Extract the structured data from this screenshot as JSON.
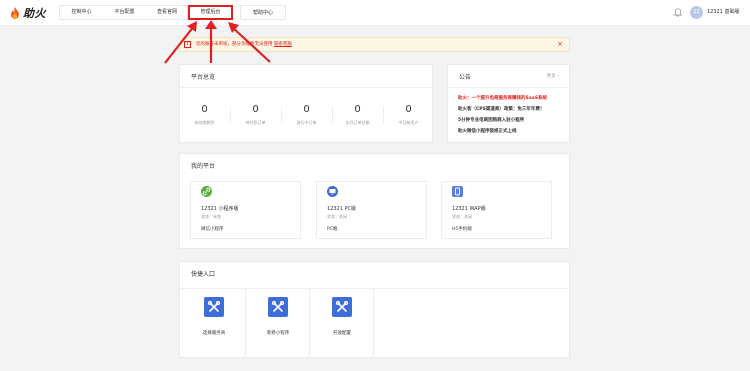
{
  "brand": {
    "name": "助火"
  },
  "nav": {
    "tabs": [
      {
        "label": "控制中心"
      },
      {
        "label": "平台配置"
      },
      {
        "label": "查看官网"
      },
      {
        "label": "管理后台"
      },
      {
        "label": "帮助中心"
      }
    ]
  },
  "header": {
    "avatar_text": "12",
    "username": "12321 基础版"
  },
  "alert": {
    "text": "您的账号未审核，部分功能暂无法使用",
    "link": "联系客服",
    "close": "×",
    "icon": "!"
  },
  "overview": {
    "title": "平台总览",
    "stats": [
      {
        "value": "0",
        "label": "有效期剩余"
      },
      {
        "value": "0",
        "label": "待付款订单"
      },
      {
        "value": "0",
        "label": "进行中订单"
      },
      {
        "value": "0",
        "label": "本月订单总额"
      },
      {
        "value": "0",
        "label": "今日新用户"
      }
    ]
  },
  "announcement": {
    "title": "公告",
    "more": "更多 ›",
    "items": [
      {
        "text": "助火：一个提升电商服务商赚钱的SaaS系统",
        "hot": true
      },
      {
        "text": "助火客（CPS渠道商）政策：免三年年费！",
        "hot": false
      },
      {
        "text": "5分钟专业电商团购商入驻小程序",
        "hot": false
      },
      {
        "text": "助火微信小程序装修正式上线",
        "hot": false
      }
    ]
  },
  "platforms": {
    "title": "我的平台",
    "items": [
      {
        "name": "12321 小程序版",
        "status": "状态：有效",
        "type": "微信小程序",
        "icon": "link-icon",
        "color": "#58b03c"
      },
      {
        "name": "12321 PC版",
        "status": "状态：关闭",
        "type": "PC端",
        "icon": "monitor-icon",
        "color": "#3d6fd6"
      },
      {
        "name": "12321 WAP版",
        "status": "状态：关闭",
        "type": "H5手机端",
        "icon": "phone-icon",
        "color": "#5b7be0"
      }
    ]
  },
  "quick": {
    "title": "快捷入口",
    "items": [
      {
        "label": "选择服务商",
        "icon": "tools-icon"
      },
      {
        "label": "装修小程序",
        "icon": "tools-icon"
      },
      {
        "label": "开放配置",
        "icon": "tools-icon"
      }
    ]
  },
  "colors": {
    "accent": "#3d6fd6",
    "alert": "#e02020",
    "alert_bg": "#fdf6e4"
  }
}
